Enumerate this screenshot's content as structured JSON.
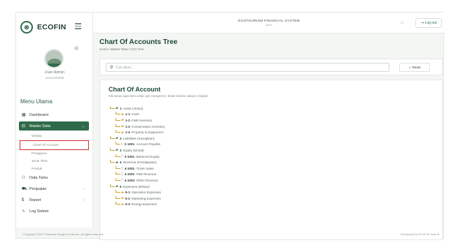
{
  "brand": {
    "name": "ECOFIN",
    "logo_glyph": "⊛"
  },
  "header": {
    "system_title": "ECOTOURISM FINANCIAL SYSTEM",
    "system_subtitle": "admin",
    "logout_label": "Log out",
    "logout_icon": "logout-icon",
    "grid_icon": "grid-icon"
  },
  "user": {
    "name": "User Admin",
    "id": "11151220095",
    "badge": "Sepucuk"
  },
  "menu": {
    "title": "Menu Utama",
    "items": [
      {
        "label": "Dashboard",
        "icon": "dashboard-icon",
        "glyph": "▦",
        "active": false
      },
      {
        "label": "Master Data",
        "icon": "database-icon",
        "glyph": "⊟",
        "active": true,
        "chevron": "⌄"
      },
      {
        "label": "Data Tamu",
        "icon": "users-icon",
        "glyph": "⚇",
        "active": false
      },
      {
        "label": "Penjualan",
        "icon": "cart-icon",
        "glyph": "⛟",
        "active": false,
        "chevron": "›"
      },
      {
        "label": "Report",
        "icon": "dollar-icon",
        "glyph": "$",
        "active": false,
        "chevron": "›"
      },
      {
        "label": "Log Sistem",
        "icon": "activity-icon",
        "glyph": "∿",
        "active": false
      }
    ],
    "master_sub": [
      "Wisata",
      "Chart Of Account",
      "Pengguna",
      "Jenis Tiket",
      "Produk"
    ]
  },
  "page": {
    "title": "Chart Of Accounts Tree",
    "breadcrumb": "Home / Master Data / COA Tree"
  },
  "search": {
    "placeholder": "Cari akun...",
    "reset_label": "✓ Reset"
  },
  "coa": {
    "title": "Chart Of Account",
    "description": "Klik kanan pada item untuk opsi manajemen. Batas struktur adalah 3 tingkat.",
    "tree": [
      {
        "level": 0,
        "code": "1",
        "name": "Asset (Aktiva)"
      },
      {
        "level": 1,
        "code": "1-1",
        "name": "Cash"
      },
      {
        "level": 1,
        "code": "1-2",
        "name": "F&B Inventory"
      },
      {
        "level": 1,
        "code": "1-3",
        "name": "Conservation Inventory"
      },
      {
        "level": 1,
        "code": "1-4",
        "name": "Property & Equipment"
      },
      {
        "level": 0,
        "code": "2",
        "name": "Liabilities (Kewajiban)"
      },
      {
        "level": 1,
        "code": "2-1001",
        "name": "Account Payable",
        "leaf": true
      },
      {
        "level": 0,
        "code": "3",
        "name": "Equity (Modal)"
      },
      {
        "level": 1,
        "code": "3-1001",
        "name": "Balanced Equity",
        "leaf": true
      },
      {
        "level": 0,
        "code": "4",
        "name": "Revenue (Pendapatan)"
      },
      {
        "level": 1,
        "code": "4-1001",
        "name": "Ticket Sales",
        "leaf": true
      },
      {
        "level": 1,
        "code": "4-1002",
        "name": "F&B Revenue",
        "leaf": true
      },
      {
        "level": 1,
        "code": "4-1003",
        "name": "Other Revenue",
        "leaf": true
      },
      {
        "level": 0,
        "code": "5",
        "name": "Expenses (Beban)"
      },
      {
        "level": 1,
        "code": "5-1",
        "name": "Operation Expenses"
      },
      {
        "level": 1,
        "code": "5-2",
        "name": "Marketing Expenses"
      },
      {
        "level": 1,
        "code": "5-3",
        "name": "Energy Expenses"
      }
    ]
  },
  "footer": {
    "copyright": "Copyright 2026 © Balaram Mangrove Heroes. All rights reserved.",
    "developed": "Developed by ECOFIN Team ♥"
  },
  "colors": {
    "accent": "#2f6b4a",
    "highlight_box": "#d1282b",
    "tree_line": "#c9a227"
  }
}
